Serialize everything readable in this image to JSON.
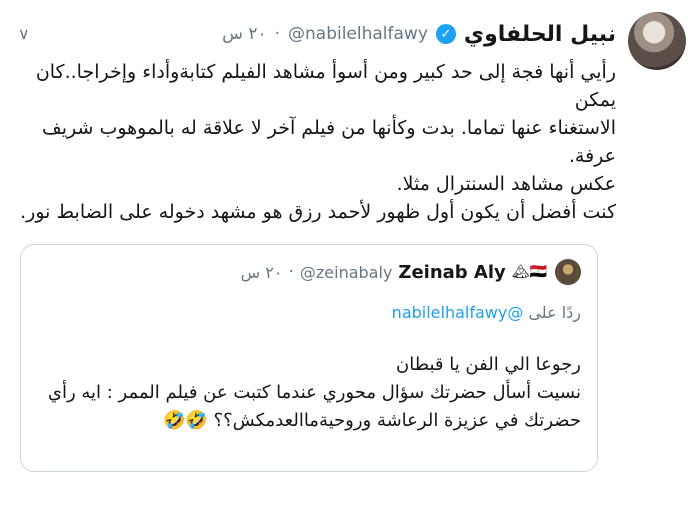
{
  "tweet": {
    "display_name": "نبيل الحلفاوي",
    "verified_mark": "✓",
    "handle": "@nabilelhalfawy",
    "separator": "·",
    "time": "٢٠ س",
    "menu_icon": "chevron-down-icon",
    "menu_glyph": "∨",
    "lines": [
      "رأيي أنها فجة إلى حد كبير ومن أسوأ مشاهد الفيلم كتابةوأداء وإخراجا..كان يمكن",
      "الاستغناء عنها تماما. بدت وكأنها من فيلم آخر لا علاقة له بالموهوب شريف عرفة.",
      "عكس مشاهد السنترال مثلا.",
      "كنت أفضل أن يكون أول ظهور لأحمد رزق هو مشهد دخوله على الضابط نور."
    ]
  },
  "quote": {
    "display_name": "Zeinab Aly",
    "flags": "🇪🇬🏔",
    "handle": "@zeinabaly",
    "separator": "·",
    "time": "٢٠ س",
    "reply_prefix": "ردًا على",
    "reply_mention": "@nabilelhalfawy",
    "lines": [
      "رجوعا الي الفن يا قبطان",
      "نسيت أسأل حضرتك سؤال محوري عندما كتبت عن فيلم الممر : ايه رأي",
      "حضرتك في عزيزة الرعاشة وروحيةماالعدمكش؟؟ 🤣🤣"
    ]
  },
  "colors": {
    "accent": "#1da1f2",
    "muted": "#657786",
    "text": "#14171a",
    "border": "#ccd6dd"
  }
}
